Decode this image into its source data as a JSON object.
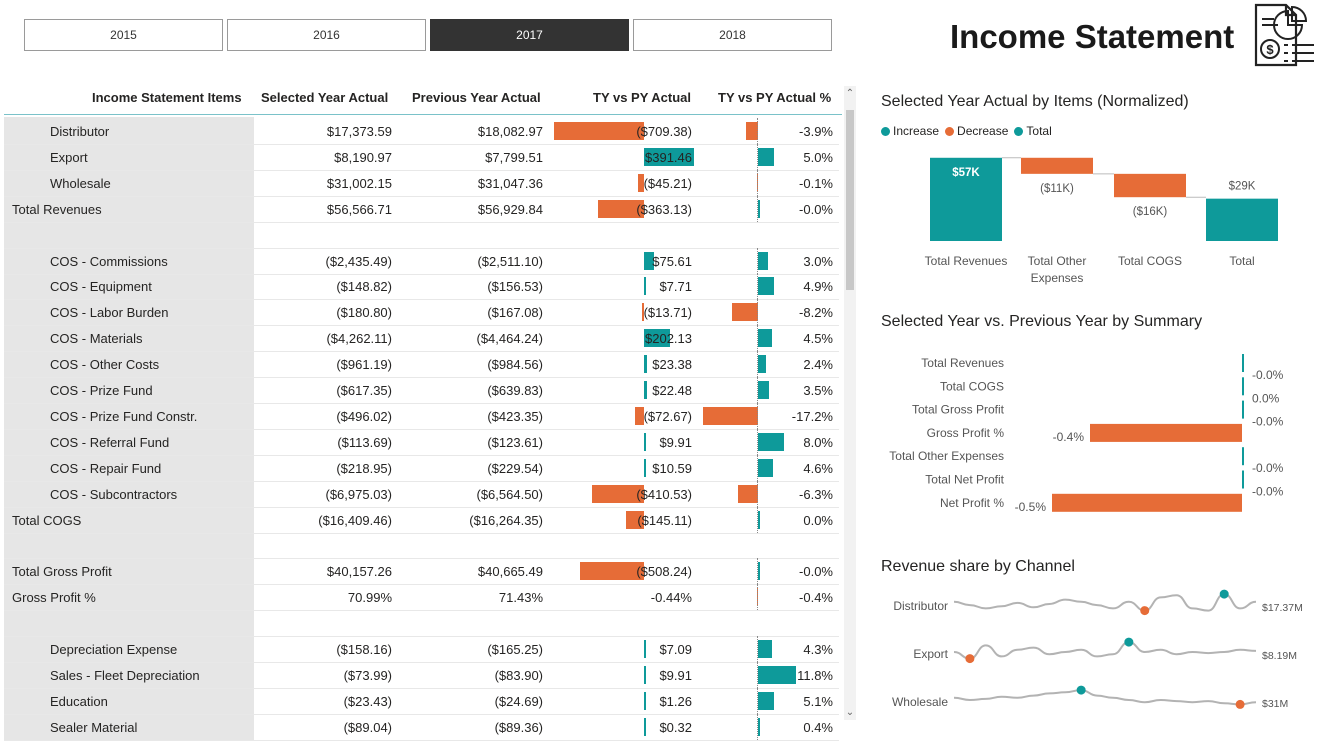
{
  "slicer": {
    "years": [
      "2015",
      "2016",
      "2017",
      "2018"
    ],
    "selected": "2017"
  },
  "page_title": "Income Statement",
  "table": {
    "headers": [
      "Income Statement Items",
      "Selected Year Actual",
      "Previous Year Actual",
      "TY vs PY Actual",
      "TY vs PY Actual %"
    ],
    "rows": [
      {
        "label": "Distributor",
        "indent": true,
        "sel": "$17,373.59",
        "prev": "$18,082.97",
        "diff": "($709.38)",
        "pct": "-3.9%",
        "diffv": -709.38,
        "pctv": -3.9
      },
      {
        "label": "Export",
        "indent": true,
        "sel": "$8,190.97",
        "prev": "$7,799.51",
        "diff": "$391.46",
        "pct": "5.0%",
        "diffv": 391.46,
        "pctv": 5.0
      },
      {
        "label": "Wholesale",
        "indent": true,
        "sel": "$31,002.15",
        "prev": "$31,047.36",
        "diff": "($45.21)",
        "pct": "-0.1%",
        "diffv": -45.21,
        "pctv": -0.1
      },
      {
        "label": "Total Revenues",
        "indent": false,
        "sel": "$56,566.71",
        "prev": "$56,929.84",
        "diff": "($363.13)",
        "pct": "-0.0%",
        "diffv": -363.13,
        "pctv": -0.0
      },
      {
        "label": "",
        "indent": false,
        "sel": "",
        "prev": "",
        "diff": "",
        "pct": "",
        "diffv": 0,
        "pctv": 0
      },
      {
        "label": "COS - Commissions",
        "indent": true,
        "sel": "($2,435.49)",
        "prev": "($2,511.10)",
        "diff": "$75.61",
        "pct": "3.0%",
        "diffv": 75.61,
        "pctv": 3.0
      },
      {
        "label": "COS - Equipment",
        "indent": true,
        "sel": "($148.82)",
        "prev": "($156.53)",
        "diff": "$7.71",
        "pct": "4.9%",
        "diffv": 7.71,
        "pctv": 4.9
      },
      {
        "label": "COS - Labor Burden",
        "indent": true,
        "sel": "($180.80)",
        "prev": "($167.08)",
        "diff": "($13.71)",
        "pct": "-8.2%",
        "diffv": -13.71,
        "pctv": -8.2
      },
      {
        "label": "COS - Materials",
        "indent": true,
        "sel": "($4,262.11)",
        "prev": "($4,464.24)",
        "diff": "$202.13",
        "pct": "4.5%",
        "diffv": 202.13,
        "pctv": 4.5
      },
      {
        "label": "COS - Other Costs",
        "indent": true,
        "sel": "($961.19)",
        "prev": "($984.56)",
        "diff": "$23.38",
        "pct": "2.4%",
        "diffv": 23.38,
        "pctv": 2.4
      },
      {
        "label": "COS - Prize Fund",
        "indent": true,
        "sel": "($617.35)",
        "prev": "($639.83)",
        "diff": "$22.48",
        "pct": "3.5%",
        "diffv": 22.48,
        "pctv": 3.5
      },
      {
        "label": "COS - Prize Fund Constr.",
        "indent": true,
        "sel": "($496.02)",
        "prev": "($423.35)",
        "diff": "($72.67)",
        "pct": "-17.2%",
        "diffv": -72.67,
        "pctv": -17.2
      },
      {
        "label": "COS - Referral Fund",
        "indent": true,
        "sel": "($113.69)",
        "prev": "($123.61)",
        "diff": "$9.91",
        "pct": "8.0%",
        "diffv": 9.91,
        "pctv": 8.0
      },
      {
        "label": "COS - Repair Fund",
        "indent": true,
        "sel": "($218.95)",
        "prev": "($229.54)",
        "diff": "$10.59",
        "pct": "4.6%",
        "diffv": 10.59,
        "pctv": 4.6
      },
      {
        "label": "COS - Subcontractors",
        "indent": true,
        "sel": "($6,975.03)",
        "prev": "($6,564.50)",
        "diff": "($410.53)",
        "pct": "-6.3%",
        "diffv": -410.53,
        "pctv": -6.3
      },
      {
        "label": "Total COGS",
        "indent": false,
        "sel": "($16,409.46)",
        "prev": "($16,264.35)",
        "diff": "($145.11)",
        "pct": "0.0%",
        "diffv": -145.11,
        "pctv": 0.0
      },
      {
        "label": "",
        "indent": false,
        "sel": "",
        "prev": "",
        "diff": "",
        "pct": "",
        "diffv": 0,
        "pctv": 0
      },
      {
        "label": "Total Gross Profit",
        "indent": false,
        "sel": "$40,157.26",
        "prev": "$40,665.49",
        "diff": "($508.24)",
        "pct": "-0.0%",
        "diffv": -508.24,
        "pctv": -0.0
      },
      {
        "label": "Gross Profit %",
        "indent": false,
        "sel": "70.99%",
        "prev": "71.43%",
        "diff": "-0.44%",
        "pct": "-0.4%",
        "diffv": 0,
        "pctv": -0.4
      },
      {
        "label": "",
        "indent": false,
        "sel": "",
        "prev": "",
        "diff": "",
        "pct": "",
        "diffv": 0,
        "pctv": 0
      },
      {
        "label": "Depreciation Expense",
        "indent": true,
        "sel": "($158.16)",
        "prev": "($165.25)",
        "diff": "$7.09",
        "pct": "4.3%",
        "diffv": 7.09,
        "pctv": 4.3
      },
      {
        "label": "Sales - Fleet Depreciation",
        "indent": true,
        "sel": "($73.99)",
        "prev": "($83.90)",
        "diff": "$9.91",
        "pct": "11.8%",
        "diffv": 9.91,
        "pctv": 11.8
      },
      {
        "label": "Education",
        "indent": true,
        "sel": "($23.43)",
        "prev": "($24.69)",
        "diff": "$1.26",
        "pct": "5.1%",
        "diffv": 1.26,
        "pctv": 5.1
      },
      {
        "label": "Sealer Material",
        "indent": true,
        "sel": "($89.04)",
        "prev": "($89.36)",
        "diff": "$0.32",
        "pct": "0.4%",
        "diffv": 0.32,
        "pctv": 0.4
      }
    ]
  },
  "waterfall": {
    "title": "Selected Year Actual by Items (Normalized)",
    "legend": [
      {
        "label": "Increase",
        "color": "#118dff"
      },
      {
        "label": "Decrease",
        "color": "#e66c37"
      },
      {
        "label": "Total",
        "color": "#0e9a9a"
      }
    ]
  },
  "summary": {
    "title": "Selected Year vs. Previous Year by Summary"
  },
  "sparklines": {
    "title": "Revenue share by Channel"
  },
  "colors": {
    "increase": "#0e9a9a",
    "decrease": "#e66c37",
    "legend_increase": "#0e9a9a"
  },
  "chart_data": [
    {
      "type": "bar",
      "title": "Selected Year Actual by Items (Normalized)",
      "categories": [
        "Total Revenues",
        "Total Other Expenses",
        "Total COGS",
        "Total"
      ],
      "values": [
        57,
        -11,
        -16,
        29
      ],
      "data_labels": [
        "$57K",
        "($11K)",
        "($16K)",
        "$29K"
      ],
      "legend": [
        "Increase",
        "Decrease",
        "Total"
      ]
    },
    {
      "type": "bar",
      "title": "Selected Year vs. Previous Year by Summary",
      "categories": [
        "Total Revenues",
        "Total COGS",
        "Total Gross Profit",
        "Gross Profit %",
        "Total Other Expenses",
        "Total Net Profit",
        "Net Profit %"
      ],
      "values": [
        -0.0,
        0.0,
        -0.0,
        -0.4,
        -0.0,
        -0.0,
        -0.5
      ],
      "data_labels": [
        "-0.0%",
        "0.0%",
        "-0.0%",
        "-0.4%",
        "-0.0%",
        "-0.0%",
        "-0.5%"
      ]
    },
    {
      "type": "line",
      "title": "Revenue share by Channel",
      "series": [
        {
          "name": "Distributor",
          "values": [
            0.6,
            0.45,
            0.3,
            0.4,
            0.55,
            0.35,
            0.5,
            0.7,
            0.6,
            0.45,
            0.3,
            0.6,
            0.2,
            0.8,
            0.9,
            0.3,
            0.2,
            0.95,
            0.3,
            0.6
          ],
          "label": "$17.37M"
        },
        {
          "name": "Export",
          "values": [
            0.5,
            0.2,
            0.8,
            0.3,
            0.6,
            0.7,
            0.4,
            0.5,
            0.6,
            0.3,
            0.4,
            0.95,
            0.5,
            0.6,
            0.4,
            0.5,
            0.45,
            0.5,
            0.6,
            0.55
          ],
          "label": "$8.19M"
        },
        {
          "name": "Wholesale",
          "values": [
            0.6,
            0.5,
            0.55,
            0.65,
            0.6,
            0.7,
            0.8,
            0.85,
            0.95,
            0.7,
            0.6,
            0.5,
            0.4,
            0.5,
            0.45,
            0.4,
            0.45,
            0.35,
            0.3,
            0.4
          ],
          "label": "$31M"
        }
      ]
    }
  ]
}
